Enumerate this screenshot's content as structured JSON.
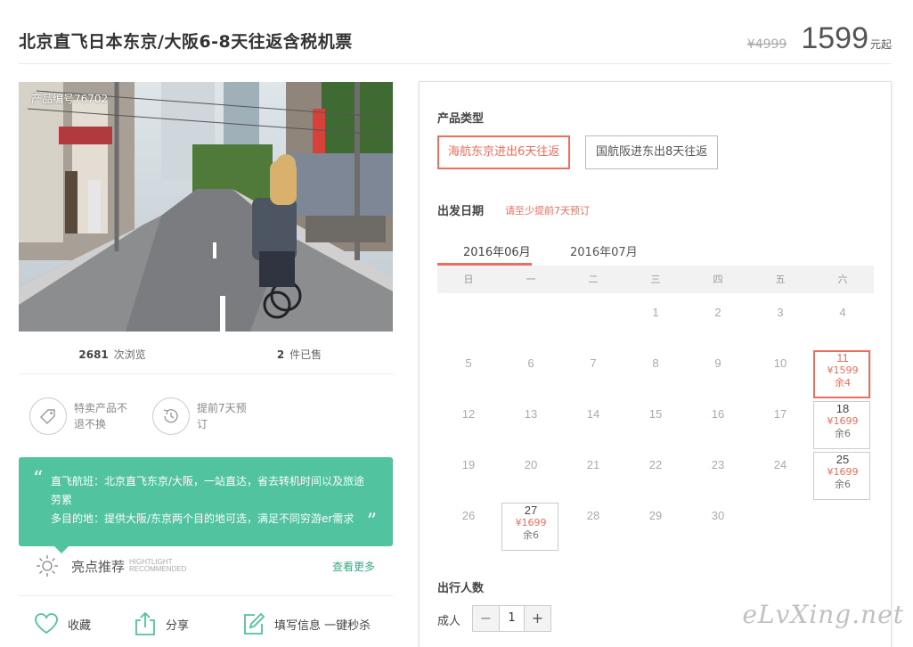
{
  "product": {
    "title": "北京直飞日本东京/大阪6-8天往返含税机票",
    "original_price": "¥4999",
    "price": "1599",
    "price_unit": "元起",
    "photo_code": "产品编号76702",
    "views_num": "2681",
    "views_label": "次浏览",
    "sold_num": "2",
    "sold_label": "件已售"
  },
  "tags": [
    {
      "icon": "price-tag-icon",
      "label": "特卖产品不退不换"
    },
    {
      "icon": "clock-history-icon",
      "label": "提前7天预订"
    }
  ],
  "highlight": {
    "line1": "直飞航班：北京直飞东京/大阪，一站直达，省去转机时间以及旅途劳累",
    "line2": "多目的地：提供大阪/东京两个目的地可选，满足不同穷游er需求",
    "title": "亮点推荐",
    "sub1": "HIGHTLIGHT",
    "sub2": "RECOMMENDED",
    "more": "查看更多"
  },
  "actions": {
    "favorite": "收藏",
    "share": "分享",
    "fill": "填写信息 一键秒杀"
  },
  "booking": {
    "type_title": "产品类型",
    "types": [
      "海航东京进出6天往返",
      "国航阪进东出8天往返"
    ],
    "date_title": "出发日期",
    "date_note": "请至少提前7天预订",
    "months": [
      "2016年06月",
      "2016年07月"
    ],
    "weekdays": [
      "日",
      "一",
      "二",
      "三",
      "四",
      "五",
      "六"
    ],
    "weeks": [
      [
        {
          "d": ""
        },
        {
          "d": ""
        },
        {
          "d": ""
        },
        {
          "d": "1"
        },
        {
          "d": "2"
        },
        {
          "d": "3"
        },
        {
          "d": "4"
        }
      ],
      [
        {
          "d": "5"
        },
        {
          "d": "6"
        },
        {
          "d": "7"
        },
        {
          "d": "8"
        },
        {
          "d": "9"
        },
        {
          "d": "10"
        },
        {
          "d": "11",
          "price": "¥1599",
          "rem": "余4",
          "selected": true
        }
      ],
      [
        {
          "d": "12"
        },
        {
          "d": "13"
        },
        {
          "d": "14"
        },
        {
          "d": "15"
        },
        {
          "d": "16"
        },
        {
          "d": "17"
        },
        {
          "d": "18",
          "price": "¥1699",
          "rem": "余6"
        }
      ],
      [
        {
          "d": "19"
        },
        {
          "d": "20"
        },
        {
          "d": "21"
        },
        {
          "d": "22"
        },
        {
          "d": "23"
        },
        {
          "d": "24"
        },
        {
          "d": "25",
          "price": "¥1699",
          "rem": "余6"
        }
      ],
      [
        {
          "d": "26"
        },
        {
          "d": "27",
          "price": "¥1699",
          "rem": "余6"
        },
        {
          "d": "28"
        },
        {
          "d": "29"
        },
        {
          "d": "30"
        },
        {
          "d": ""
        },
        {
          "d": ""
        }
      ]
    ],
    "people_title": "出行人数",
    "adult_label": "成人",
    "minus": "−",
    "adult_count": "1",
    "plus": "+"
  },
  "watermark": "eLvXing.net",
  "colors": {
    "accent": "#ee6e5e",
    "green": "#51c39e"
  }
}
